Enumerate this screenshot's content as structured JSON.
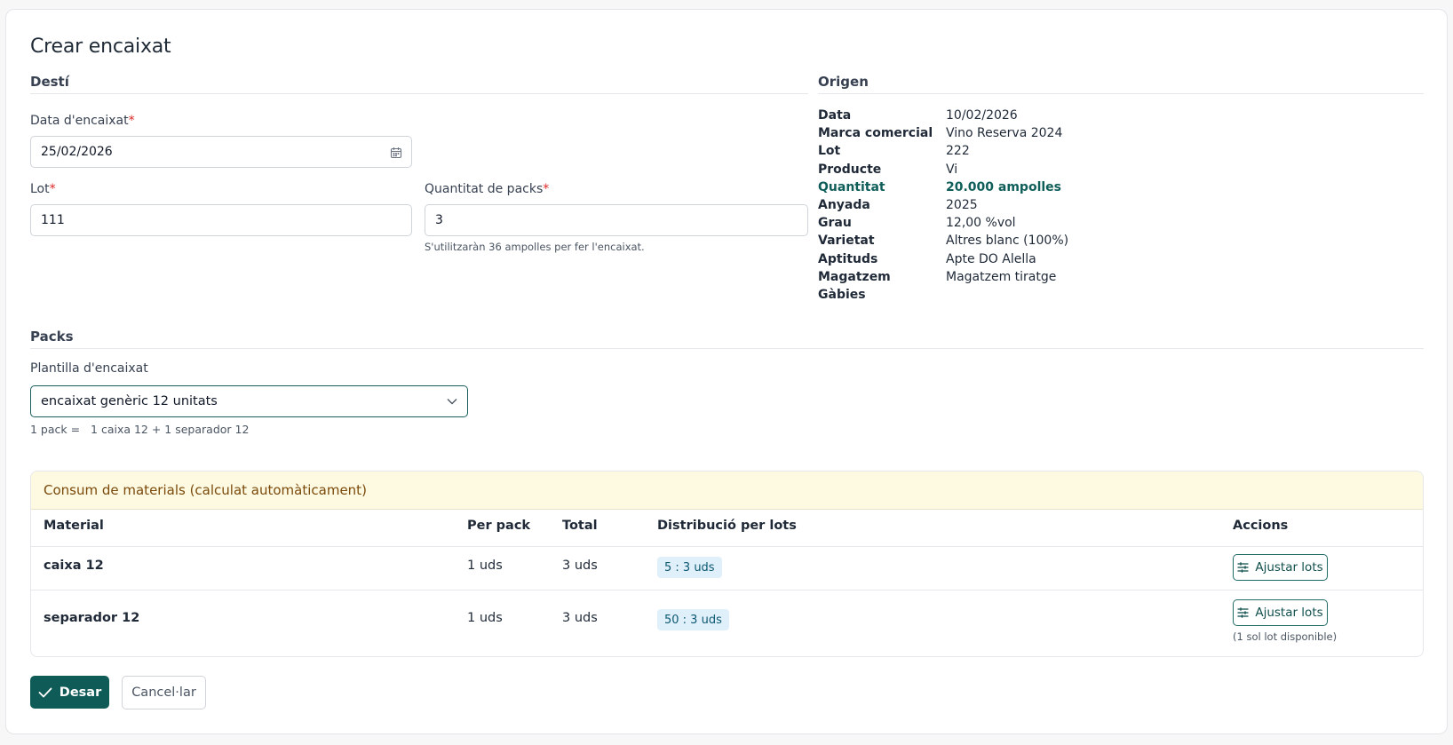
{
  "page": {
    "title": "Crear encaixat"
  },
  "desti": {
    "title": "Destí",
    "date_label": "Data d'encaixat",
    "date_value": "25/02/2026",
    "lot_label": "Lot",
    "lot_value": "111",
    "qty_label": "Quantitat de packs",
    "qty_value": "3",
    "qty_hint": "S'utilitzaràn 36 ampolles per fer l'encaixat.",
    "required_mark": "*"
  },
  "origen": {
    "title": "Origen",
    "rows": [
      {
        "key": "Data",
        "value": "10/02/2026"
      },
      {
        "key": "Marca comercial",
        "value": "Vino Reserva 2024"
      },
      {
        "key": "Lot",
        "value": "222"
      },
      {
        "key": "Producte",
        "value": "Vi"
      },
      {
        "key": "Quantitat",
        "value": "20.000 ampolles"
      },
      {
        "key": "Anyada",
        "value": "2025"
      },
      {
        "key": "Grau",
        "value": "12,00 %vol"
      },
      {
        "key": "Varietat",
        "value": "Altres blanc (100%)"
      },
      {
        "key": "Aptituds",
        "value": "Apte DO Alella"
      },
      {
        "key": "Magatzem",
        "value": "Magatzem tiratge"
      },
      {
        "key": "Gàbies",
        "value": ""
      }
    ],
    "highlight_color": "#0f5e5a"
  },
  "packs": {
    "title": "Packs",
    "template_label": "Plantilla d'encaixat",
    "template_value": "encaixat genèric 12 unitats",
    "formula_prefix": "1 pack =",
    "formula_value": "1 caixa 12 + 1 separador 12"
  },
  "materials": {
    "title": "Consum de materials (calculat automàticament)",
    "headers": {
      "material": "Material",
      "per_pack": "Per pack",
      "total": "Total",
      "distribution": "Distribució per lots",
      "actions": "Accions"
    },
    "rows": [
      {
        "material": "caixa 12",
        "per_pack": "1 uds",
        "total": "3 uds",
        "lot_chip": "5 :  3 uds",
        "action": "Ajustar lots",
        "note": ""
      },
      {
        "material": "separador 12",
        "per_pack": "1 uds",
        "total": "3 uds",
        "lot_chip": "50 :  3 uds",
        "action": "Ajustar lots",
        "note": "(1 sol lot disponible)"
      }
    ]
  },
  "actions": {
    "save": "Desar",
    "cancel": "Cancel·lar"
  },
  "colors": {
    "primary": "#0f5b58",
    "required": "#dc2626",
    "warning_bg": "#fef9e1",
    "chip_bg": "#e0f0fb"
  }
}
